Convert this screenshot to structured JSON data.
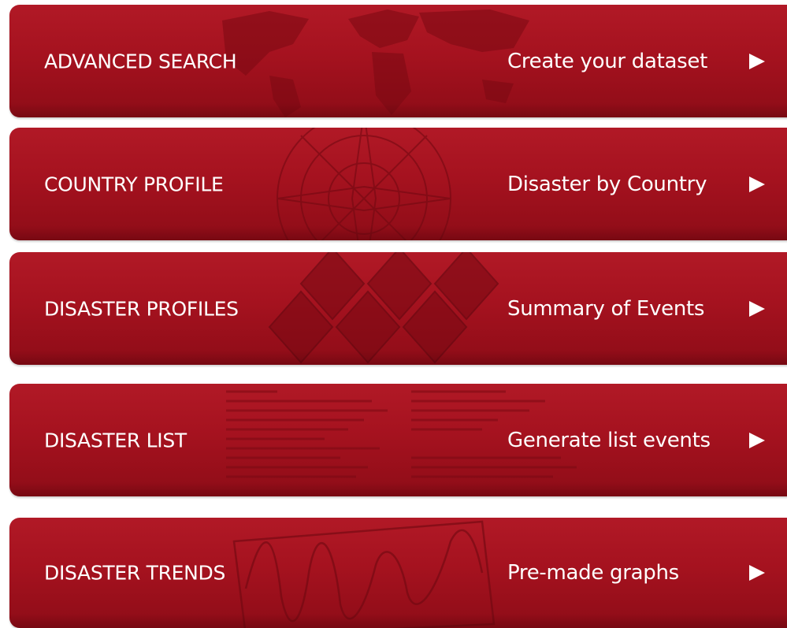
{
  "menu": {
    "items": [
      {
        "title": "ADVANCED SEARCH",
        "subtitle": "Create your dataset",
        "icon": "world-map-icon"
      },
      {
        "title": "COUNTRY PROFILE",
        "subtitle": "Disaster by Country",
        "icon": "compass-icon"
      },
      {
        "title": "DISASTER PROFILES",
        "subtitle": "Summary of Events",
        "icon": "hazard-signs-icon"
      },
      {
        "title": "DISASTER LIST",
        "subtitle": "Generate list events",
        "icon": "code-listing-icon"
      },
      {
        "title": "DISASTER TRENDS",
        "subtitle": "Pre-made graphs",
        "icon": "trend-graph-icon"
      }
    ],
    "arrow_icon": "play-arrow-icon",
    "colors": {
      "panel_top": "#b11926",
      "panel_bottom": "#8e0c17",
      "text": "#ffffff"
    }
  }
}
